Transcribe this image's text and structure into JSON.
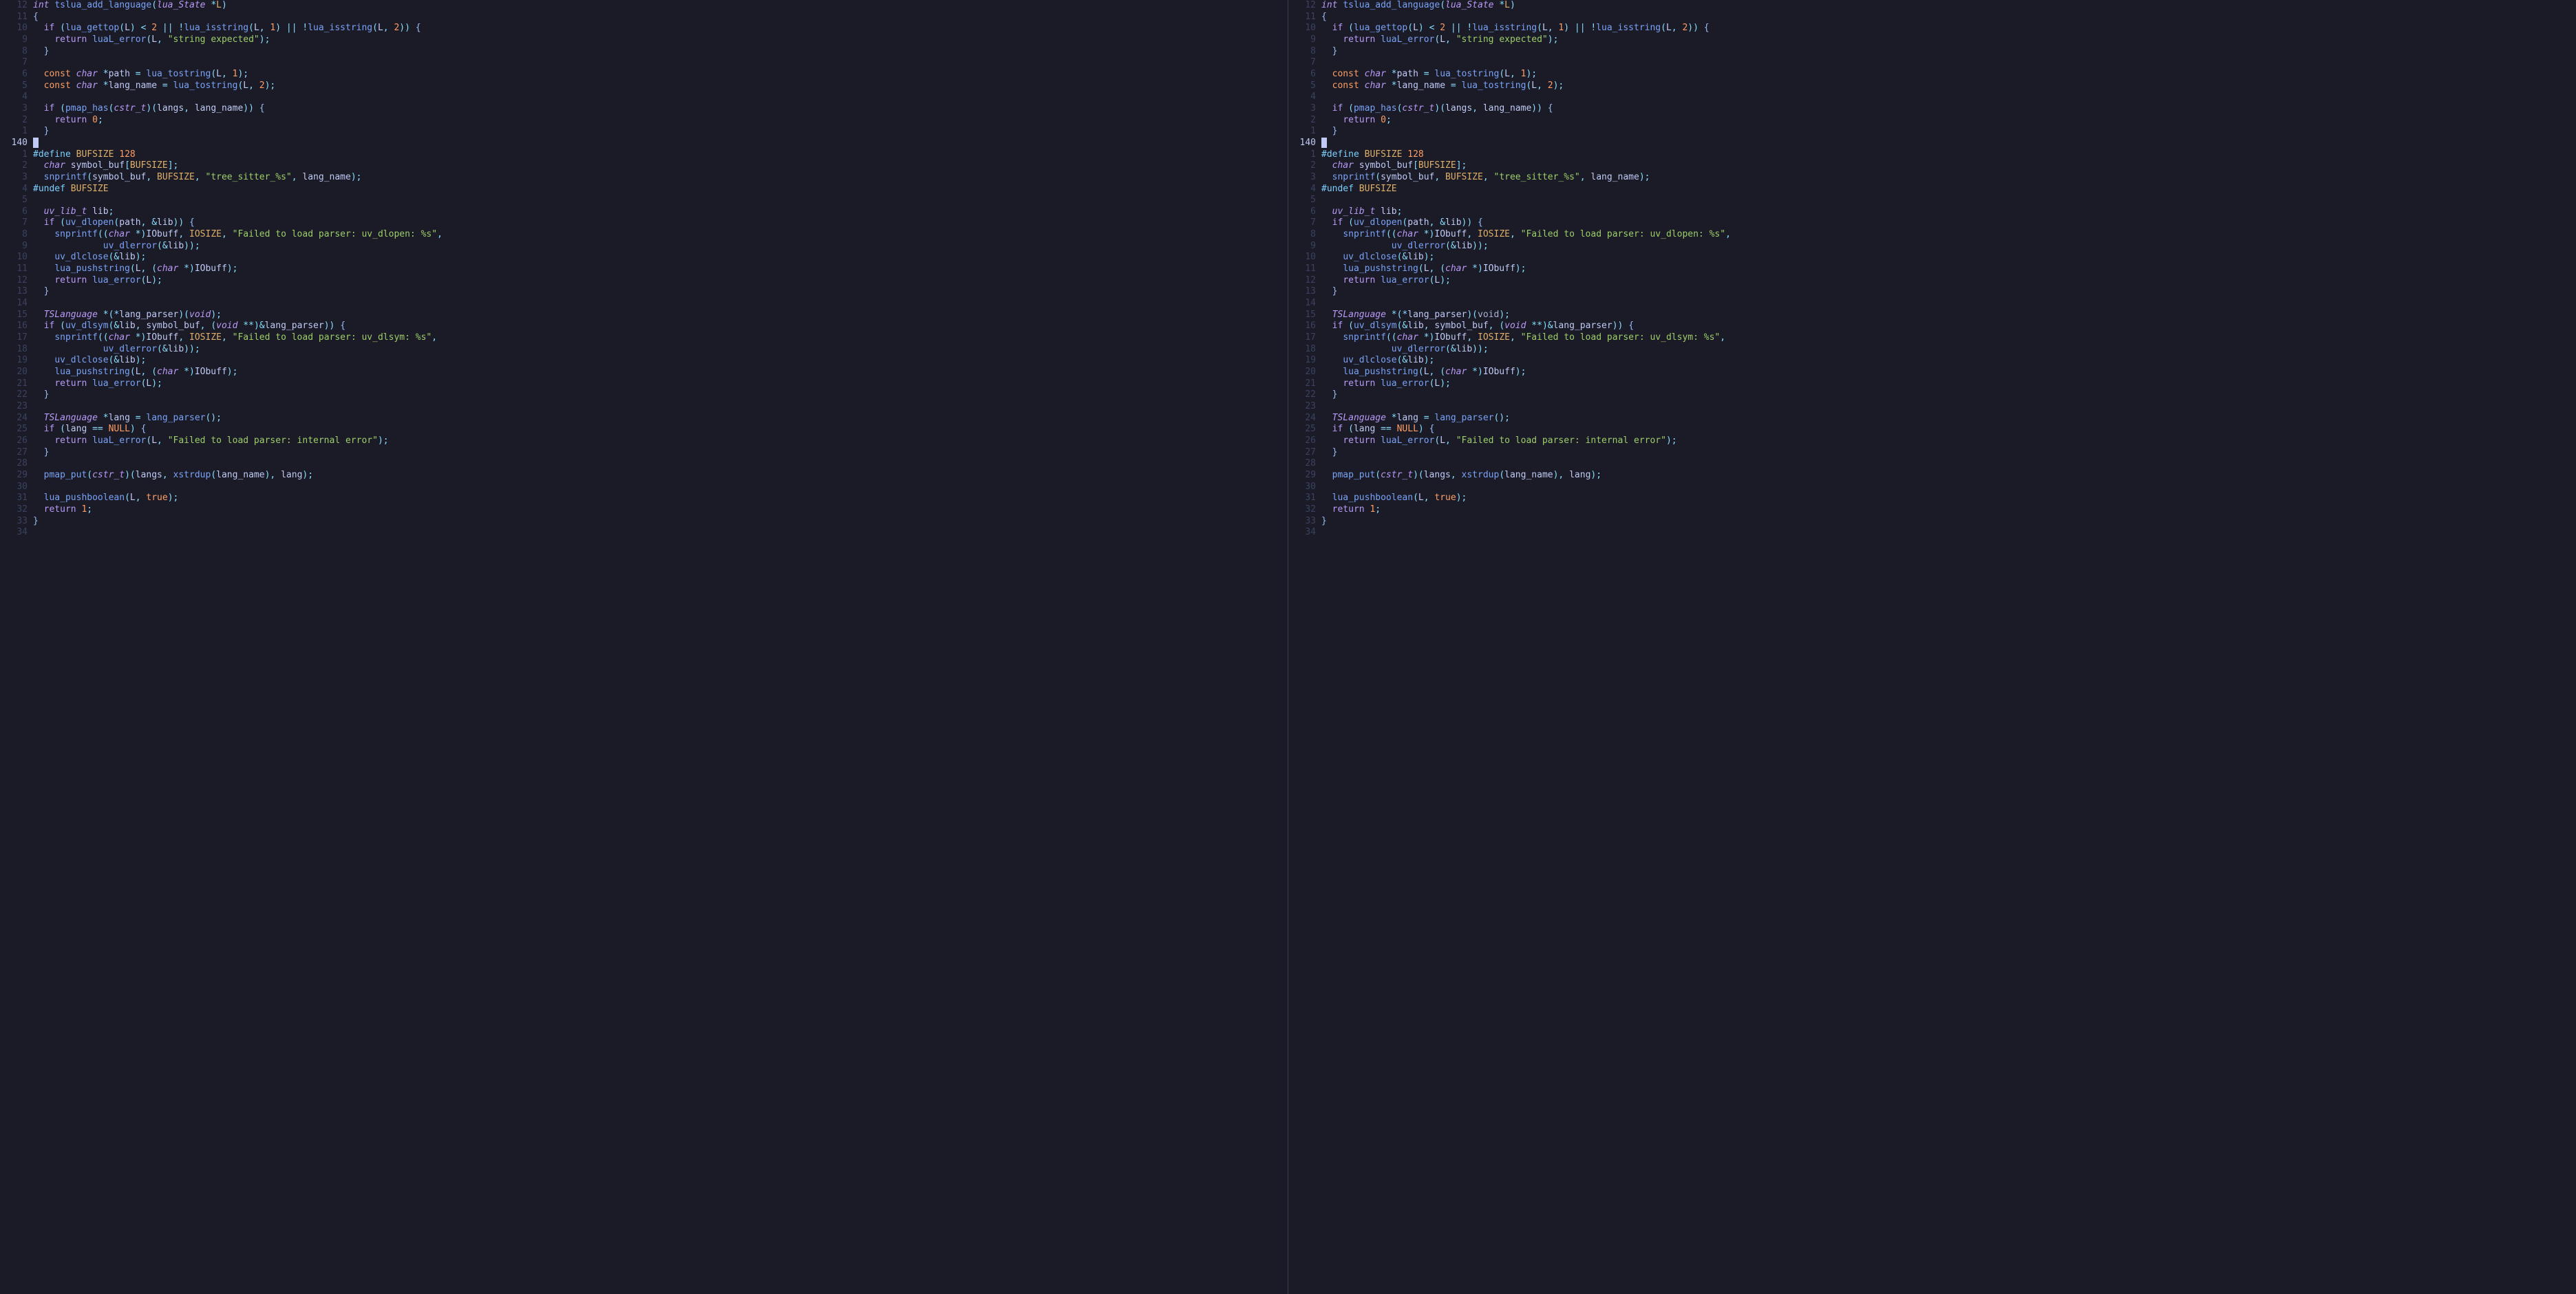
{
  "editor": {
    "cursor_line_abs": 140,
    "left_gutter": [
      "12",
      "11",
      "10",
      "9",
      "8",
      "7",
      "6",
      "5",
      "4",
      "3",
      "2",
      "1",
      "140",
      "1",
      "2",
      "3",
      "4",
      "5",
      "6",
      "7",
      "8",
      "9",
      "10",
      "11",
      "12",
      "13",
      "14",
      "15",
      "16",
      "17",
      "18",
      "19",
      "20",
      "21",
      "22",
      "23",
      "24",
      "25",
      "26",
      "27",
      "28",
      "29",
      "30",
      "31",
      "32",
      "33",
      "34"
    ],
    "right_gutter": [
      "12",
      "11",
      "10",
      "9",
      "8",
      "7",
      "6",
      "5",
      "4",
      "3",
      "2",
      "1",
      "140",
      "1",
      "2",
      "3",
      "4",
      "5",
      "6",
      "7",
      "8",
      "9",
      "10",
      "11",
      "12",
      "13",
      "14",
      "15",
      "16",
      "17",
      "18",
      "19",
      "20",
      "21",
      "22",
      "23",
      "24",
      "25",
      "26",
      "27",
      "28",
      "29",
      "30",
      "31",
      "32",
      "33",
      "34"
    ]
  },
  "tokens": {
    "int": "int",
    "char": "char",
    "void": "void",
    "const": "const",
    "if": "if",
    "return": "return",
    "true": "true",
    "NULL": "NULL",
    "define": "#define",
    "undef": "#undef",
    "BUFSIZE": "BUFSIZE",
    "BUFSIZE_num": "128",
    "IOSIZE": "IOSIZE",
    "lua_State": "lua_State",
    "cstr_t": "cstr_t",
    "uv_lib_t": "uv_lib_t",
    "TSLanguage": "TSLanguage",
    "fn_decl": "tslua_add_language",
    "lua_gettop": "lua_gettop",
    "lua_isstring": "lua_isstring",
    "luaL_error": "luaL_error",
    "lua_tostring": "lua_tostring",
    "pmap_has": "pmap_has",
    "snprintf": "snprintf",
    "uv_dlopen": "uv_dlopen",
    "uv_dlerror": "uv_dlerror",
    "uv_dlclose": "uv_dlclose",
    "lua_pushstring": "lua_pushstring",
    "lua_error": "lua_error",
    "uv_dlsym": "uv_dlsym",
    "lang_parser": "lang_parser",
    "xstrdup": "xstrdup",
    "pmap_put": "pmap_put",
    "lua_pushboolean": "lua_pushboolean",
    "L": "L",
    "path": "path",
    "lang_name": "lang_name",
    "langs": "langs",
    "symbol_buf": "symbol_buf",
    "lib": "lib",
    "IObuff": "IObuff",
    "lang": "lang",
    "n0": "0",
    "n1": "1",
    "n2": "2",
    "str_expected": "\"string expected\"",
    "str_tree_sitter": "\"tree_sitter_%s\"",
    "str_dlopen": "\"Failed to load parser: uv_dlopen: %s\"",
    "str_dlsym": "\"Failed to load parser: uv_dlsym: %s\"",
    "str_internal": "\"Failed to load parser: internal error\""
  }
}
